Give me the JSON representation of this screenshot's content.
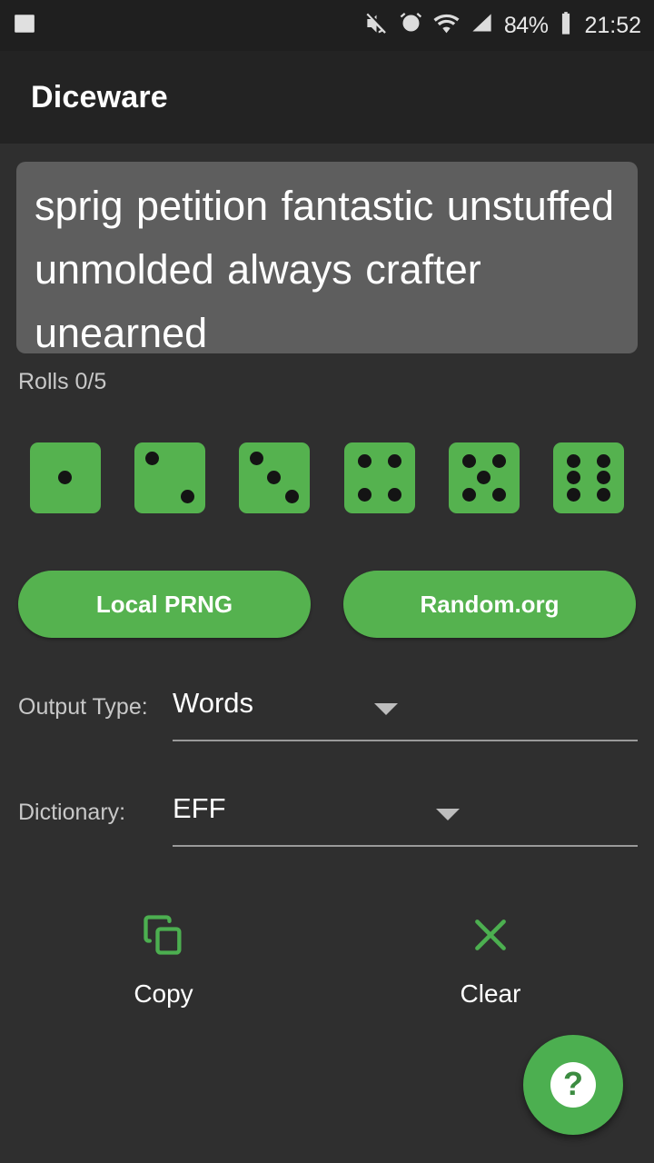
{
  "status_bar": {
    "left_icons": [
      "image-icon"
    ],
    "right_icons": [
      "mute-icon",
      "alarm-icon",
      "wifi-icon",
      "signal-icon",
      "battery-icon"
    ],
    "battery_percent": "84%",
    "clock": "21:52"
  },
  "app_bar": {
    "title": "Diceware"
  },
  "passphrase": {
    "text": "sprig petition fantastic unstuffed unmolded always crafter unearned"
  },
  "rolls": {
    "label": "Rolls 0/5",
    "current": 0,
    "total": 5
  },
  "dice": [
    {
      "name": "die-1",
      "value": 1
    },
    {
      "name": "die-2",
      "value": 2
    },
    {
      "name": "die-3",
      "value": 3
    },
    {
      "name": "die-4",
      "value": 4
    },
    {
      "name": "die-5",
      "value": 5
    },
    {
      "name": "die-6",
      "value": 6
    }
  ],
  "generator_buttons": {
    "local": "Local PRNG",
    "remote": "Random.org"
  },
  "output_type": {
    "label": "Output Type:",
    "value": "Words"
  },
  "dictionary": {
    "label": "Dictionary:",
    "value": "EFF"
  },
  "actions": {
    "copy_label": "Copy",
    "clear_label": "Clear"
  },
  "fab": {
    "glyph": "?"
  },
  "colors": {
    "accent_green": "#55b24f",
    "fab_green": "#4caf50",
    "background": "#2f2f2f",
    "app_bar": "#232323",
    "status_bar": "#1f1f1f",
    "textbox": "#5e5e5e"
  }
}
